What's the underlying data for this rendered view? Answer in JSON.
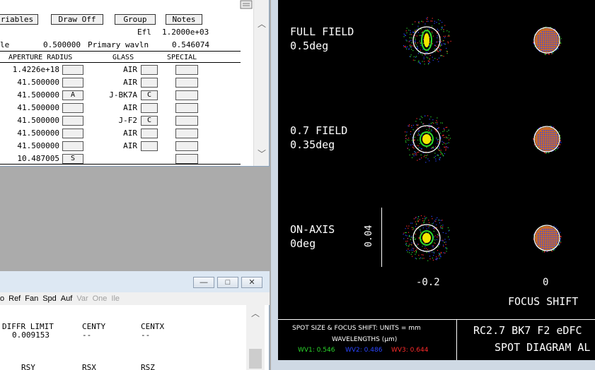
{
  "lens_editor": {
    "toolbar": {
      "variables_label": "riables",
      "draw_off_label": "Draw Off",
      "group_label": "Group",
      "notes_label": "Notes"
    },
    "efl_label": "Efl",
    "efl_value": "1.2000e+03",
    "le_label": "le",
    "le_value": "0.500000",
    "primary_wavln_label": "Primary wavln",
    "primary_wavln_value": "0.546074",
    "columns": {
      "aperture_radius": "APERTURE RADIUS",
      "glass": "GLASS",
      "special": "SPECIAL"
    },
    "rows": [
      {
        "radius": "1.4226e+18",
        "radius_code": "",
        "glass": "AIR",
        "glass_code": ""
      },
      {
        "radius": "41.500000",
        "radius_code": "",
        "glass": "AIR",
        "glass_code": ""
      },
      {
        "radius": "41.500000",
        "radius_code": "A",
        "glass": "J-BK7A",
        "glass_code": "C"
      },
      {
        "radius": "41.500000",
        "radius_code": "",
        "glass": "AIR",
        "glass_code": ""
      },
      {
        "radius": "41.500000",
        "radius_code": "",
        "glass": "J-F2",
        "glass_code": "C"
      },
      {
        "radius": "41.500000",
        "radius_code": "",
        "glass": "AIR",
        "glass_code": ""
      },
      {
        "radius": "41.500000",
        "radius_code": "",
        "glass": "AIR",
        "glass_code": ""
      },
      {
        "radius": "10.487005",
        "radius_code": "S",
        "glass": "",
        "glass_code": ""
      }
    ]
  },
  "spot_diagram": {
    "fields": [
      {
        "name": "FULL FIELD",
        "angle": "0.5deg"
      },
      {
        "name": "0.7 FIELD",
        "angle": "0.35deg"
      },
      {
        "name": "ON-AXIS",
        "angle": "0deg"
      }
    ],
    "scale_label": "0.04",
    "focus_values": [
      "-0.2",
      "0"
    ],
    "focus_shift_label": "FOCUS SHIFT",
    "info": {
      "units_line": "SPOT SIZE & FOCUS SHIFT: UNITS = mm",
      "wavelengths_line": "WAVELENGTHS (μm)",
      "wv1": "WV1: 0.546",
      "wv2": "WV2: 0.486",
      "wv3": "WV3: 0.644",
      "title_line1": "RC2.7 BK7 F2 eDFC",
      "title_line2": "SPOT DIAGRAM AL"
    },
    "colors": {
      "wv1": "#2bd62b",
      "wv2": "#2a45ff",
      "wv3": "#ff2b2b",
      "spot_center": "#f2e600"
    }
  },
  "analysis_window": {
    "menu": [
      "o",
      "Ref",
      "Fan",
      "Spd",
      "Auf",
      "Var",
      "One",
      "Ile"
    ],
    "menu_disabled": [
      false,
      false,
      false,
      false,
      false,
      true,
      true,
      true
    ],
    "headers": [
      "DIFFR LIMIT",
      "CENTY",
      "CENTX"
    ],
    "values": [
      "0.009153",
      "--",
      "--"
    ],
    "row2_headers": [
      "RSY",
      "RSX",
      "RSZ"
    ],
    "buttons": {
      "minimize": "—",
      "maximize": "□",
      "close": "✕"
    }
  }
}
